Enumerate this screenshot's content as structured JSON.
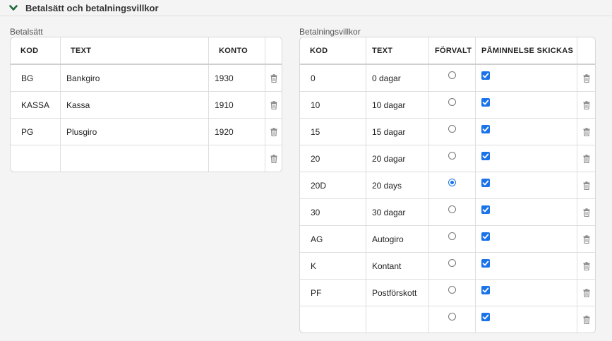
{
  "section": {
    "title": "Betalsätt och betalningsvillkor"
  },
  "betalsatt": {
    "label": "Betalsätt",
    "headers": {
      "kod": "KOD",
      "text": "TEXT",
      "konto": "KONTO"
    },
    "rows": [
      {
        "kod": "BG",
        "text": "Bankgiro",
        "konto": "1930"
      },
      {
        "kod": "KASSA",
        "text": "Kassa",
        "konto": "1910"
      },
      {
        "kod": "PG",
        "text": "Plusgiro",
        "konto": "1920"
      },
      {
        "kod": "",
        "text": "",
        "konto": ""
      }
    ]
  },
  "villkor": {
    "label": "Betalningsvillkor",
    "headers": {
      "kod": "KOD",
      "text": "TEXT",
      "forvalt": "FÖRVALT",
      "paminnelse": "PÅMINNELSE SKICKAS"
    },
    "rows": [
      {
        "kod": "0",
        "text": "0 dagar",
        "forvalt": false,
        "paminnelse": true
      },
      {
        "kod": "10",
        "text": "10 dagar",
        "forvalt": false,
        "paminnelse": true
      },
      {
        "kod": "15",
        "text": "15 dagar",
        "forvalt": false,
        "paminnelse": true
      },
      {
        "kod": "20",
        "text": "20 dagar",
        "forvalt": false,
        "paminnelse": true
      },
      {
        "kod": "20D",
        "text": "20 days",
        "forvalt": true,
        "paminnelse": true
      },
      {
        "kod": "30",
        "text": "30 dagar",
        "forvalt": false,
        "paminnelse": true
      },
      {
        "kod": "AG",
        "text": "Autogiro",
        "forvalt": false,
        "paminnelse": true
      },
      {
        "kod": "K",
        "text": "Kontant",
        "forvalt": false,
        "paminnelse": true
      },
      {
        "kod": "PF",
        "text": "Postförskott",
        "forvalt": false,
        "paminnelse": true
      },
      {
        "kod": "",
        "text": "",
        "forvalt": false,
        "paminnelse": true
      }
    ]
  },
  "colors": {
    "accent": "#1a73e8",
    "chevron": "#1e6b3a"
  },
  "icons": {
    "collapse": "chevron-down-icon",
    "delete": "trash-icon"
  }
}
